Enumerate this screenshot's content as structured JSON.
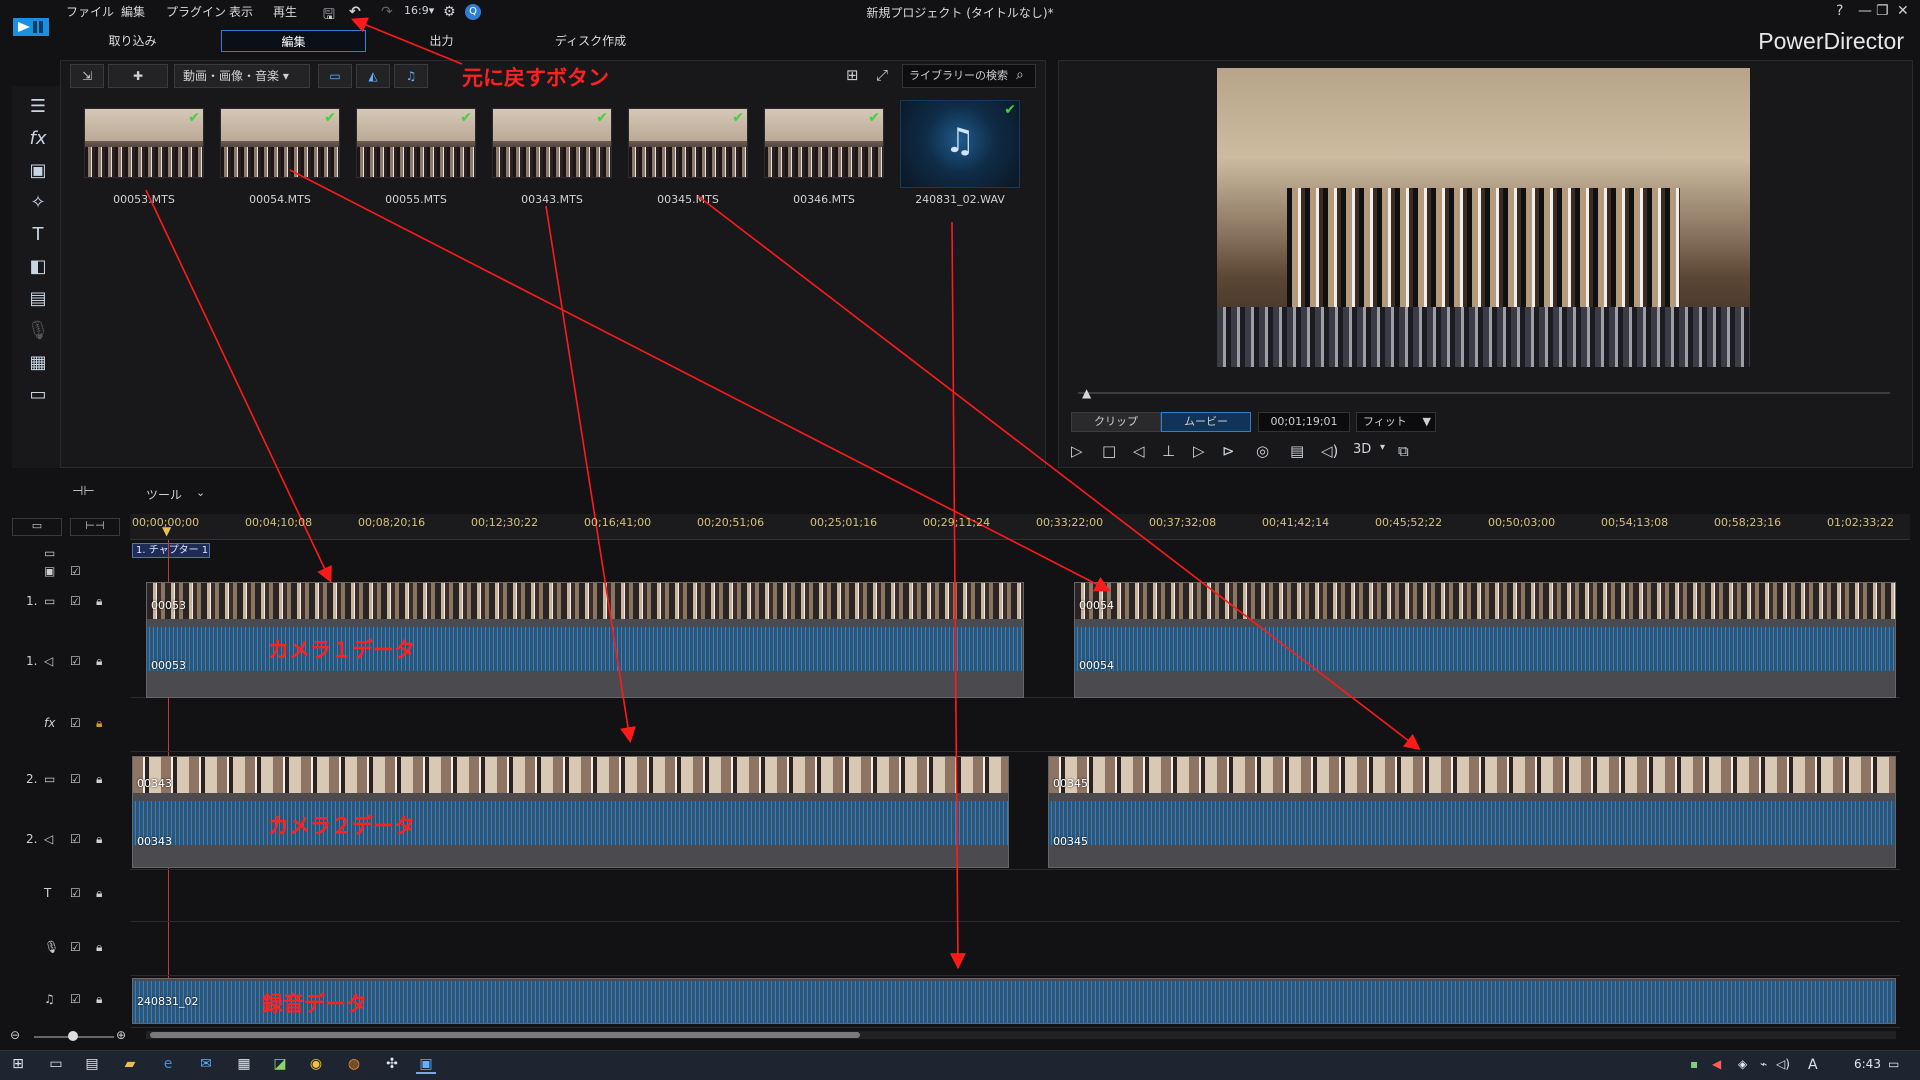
{
  "menus": [
    "ファイル",
    "編集",
    "プラグイン",
    "表示",
    "再生"
  ],
  "window_title": "新規プロジェクト (タイトルなし)*",
  "tabs": [
    "取り込み",
    "編集",
    "出力",
    "ディスク作成"
  ],
  "active_tab": "編集",
  "brand": "PowerDirector",
  "library": {
    "filter": "動画・画像・音楽",
    "search_placeholder": "ライブラリーの検索",
    "items": [
      {
        "name": "00053.MTS",
        "type": "video"
      },
      {
        "name": "00054.MTS",
        "type": "video"
      },
      {
        "name": "00055.MTS",
        "type": "video"
      },
      {
        "name": "00343.MTS",
        "type": "video"
      },
      {
        "name": "00345.MTS",
        "type": "video"
      },
      {
        "name": "00346.MTS",
        "type": "video"
      },
      {
        "name": "240831_02.WAV",
        "type": "audio"
      }
    ]
  },
  "preview": {
    "clip_tab": "クリップ",
    "movie_tab": "ムービー",
    "timecode": "00;01;19;01",
    "fit": "フィット",
    "three_d": "3D"
  },
  "annotations": {
    "undo": "元に戻すボタン",
    "cam1": "カメラ１データ",
    "cam2": "カメラ２データ",
    "audio": "録音データ"
  },
  "timeline": {
    "tools_label": "ツール",
    "ruler": [
      "00;00;00;00",
      "00;04;10;08",
      "00;08;20;16",
      "00;12;30;22",
      "00;16;41;00",
      "00;20;51;06",
      "00;25;01;16",
      "00;29;11;24",
      "00;33;22;00",
      "00;37;32;08",
      "00;41;42;14",
      "00;45;52;22",
      "00;50;03;00",
      "00;54;13;08",
      "00;58;23;16",
      "01;02;33;22"
    ],
    "chapter": "1. チャプター 1",
    "tracks": {
      "v1": "1.",
      "a1": "1.",
      "fx": "fx",
      "v2": "2.",
      "a2": "2."
    },
    "clips": {
      "v1a": "00053",
      "a1a": "00053",
      "v1b": "00054",
      "a1b": "00054",
      "v2a": "00343",
      "a2a": "00343",
      "v2b": "00345",
      "a2b": "00345",
      "music": "240831_02"
    }
  },
  "taskbar": {
    "clock": "6:43",
    "ime": "A"
  }
}
